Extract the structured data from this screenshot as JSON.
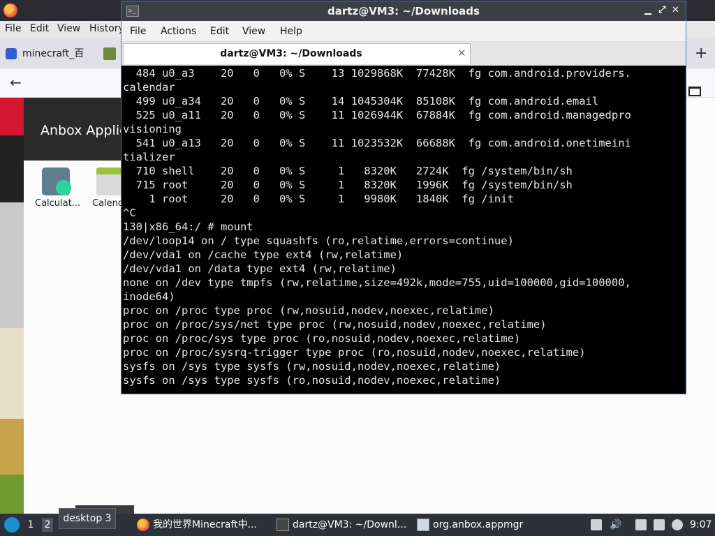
{
  "browser": {
    "menus": [
      "File",
      "Edit",
      "View",
      "History"
    ],
    "tab_label": "minecraft_百",
    "page_title": "Anbox Applic",
    "apps": [
      {
        "label": "Calculat..."
      },
      {
        "label": "Calend"
      }
    ]
  },
  "terminal": {
    "title": "dartz@VM3: ~/Downloads",
    "menus": [
      "File",
      "Actions",
      "Edit",
      "View",
      "Help"
    ],
    "tab_label": "dartz@VM3: ~/Downloads",
    "lines": [
      "  484 u0_a3    20   0   0% S    13 1029868K  77428K  fg com.android.providers.",
      "calendar",
      "  499 u0_a34   20   0   0% S    14 1045304K  85108K  fg com.android.email",
      "  525 u0_a11   20   0   0% S    11 1026944K  67884K  fg com.android.managedpro",
      "visioning",
      "  541 u0_a13   20   0   0% S    11 1023532K  66688K  fg com.android.onetimeini",
      "tializer",
      "  710 shell    20   0   0% S     1   8320K   2724K  fg /system/bin/sh",
      "  715 root     20   0   0% S     1   8320K   1996K  fg /system/bin/sh",
      "    1 root     20   0   0% S     1   9980K   1840K  fg /init",
      "^C",
      "130|x86_64:/ # mount",
      "/dev/loop14 on / type squashfs (ro,relatime,errors=continue)",
      "/dev/vda1 on /cache type ext4 (rw,relatime)",
      "/dev/vda1 on /data type ext4 (rw,relatime)",
      "none on /dev type tmpfs (rw,relatime,size=492k,mode=755,uid=100000,gid=100000,",
      "inode64)",
      "proc on /proc type proc (rw,nosuid,nodev,noexec,relatime)",
      "proc on /proc/sys/net type proc (rw,nosuid,nodev,noexec,relatime)",
      "proc on /proc/sys type proc (ro,nosuid,nodev,noexec,relatime)",
      "proc on /proc/sysrq-trigger type proc (ro,nosuid,nodev,noexec,relatime)",
      "sysfs on /sys type sysfs (rw,nosuid,nodev,noexec,relatime)",
      "sysfs on /sys type sysfs (ro,nosuid,nodev,noexec,relatime)"
    ]
  },
  "taskbar": {
    "workspaces": [
      "1",
      "2"
    ],
    "tooltip": "desktop 3",
    "windows": [
      {
        "label": "我的世界Minecraft中..."
      },
      {
        "label": "dartz@VM3: ~/Downl..."
      },
      {
        "label": "org.anbox.appmgr"
      }
    ],
    "clock": "9:07"
  },
  "colors": {
    "terminal_bg": "#000000",
    "terminal_fg": "#e5e5e5",
    "taskbar_bg": "#2c313a",
    "titlebar_bg": "#3b3f45"
  }
}
